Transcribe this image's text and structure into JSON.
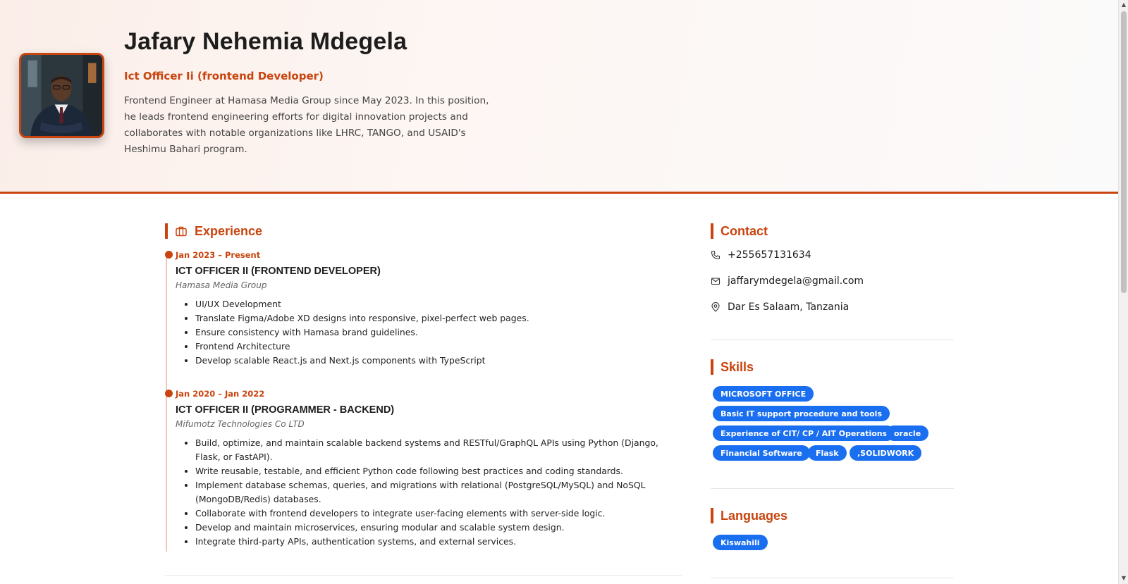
{
  "header": {
    "name": "Jafary Nehemia Mdegela",
    "role": "Ict Officer Ii (frontend Developer)",
    "bio": "Frontend Engineer at Hamasa Media Group since May 2023. In this position, he leads frontend engineering efforts for digital innovation projects and collaborates with notable organizations like LHRC, TANGO, and USAID's Heshimu Bahari program."
  },
  "experience": {
    "heading": "Experience",
    "jobs": [
      {
        "date": "Jan 2023 – Present",
        "title": "ICT OFFICER II (FRONTEND DEVELOPER)",
        "company": "Hamasa Media Group",
        "bullets": [
          "UI/UX Development",
          "Translate Figma/Adobe XD designs into responsive, pixel-perfect web pages.",
          "Ensure consistency with Hamasa brand guidelines.",
          "Frontend Architecture",
          "Develop scalable React.js and Next.js components with TypeScript"
        ]
      },
      {
        "date": "Jan 2020 – Jan 2022",
        "title": "ICT OFFICER II (PROGRAMMER - BACKEND)",
        "company": "Mifumotz Technologies Co LTD",
        "bullets": [
          "Build, optimize, and maintain scalable backend systems and RESTful/GraphQL APIs using Python (Django, Flask, or FastAPI).",
          "Write reusable, testable, and efficient Python code following best practices and coding standards.",
          "Implement database schemas, queries, and migrations with relational (PostgreSQL/MySQL) and NoSQL (MongoDB/Redis) databases.",
          "Collaborate with frontend developers to integrate user-facing elements with server-side logic.",
          "Develop and maintain microservices, ensuring modular and scalable system design.",
          "Integrate third-party APIs, authentication systems, and external services."
        ]
      }
    ]
  },
  "contact": {
    "heading": "Contact",
    "phone": "+255657131634",
    "email": "jaffarymdegela@gmail.com",
    "location": "Dar Es Salaam, Tanzania"
  },
  "skills": {
    "heading": "Skills",
    "items": [
      "MICROSOFT OFFICE",
      "Basic IT support procedure and tools",
      "Experience of CIT/ CP / AIT Operations",
      "oracle",
      "Financial Software",
      "Flask",
      ",SOLIDWORK"
    ]
  },
  "languages": {
    "heading": "Languages",
    "items": [
      "Kiswahili"
    ]
  },
  "colors": {
    "accent": "#c9440e",
    "chip": "#1a6ff0"
  },
  "icons": {
    "experience": "briefcase-icon",
    "phone": "phone-icon",
    "email": "mail-icon",
    "location": "map-pin-icon"
  }
}
